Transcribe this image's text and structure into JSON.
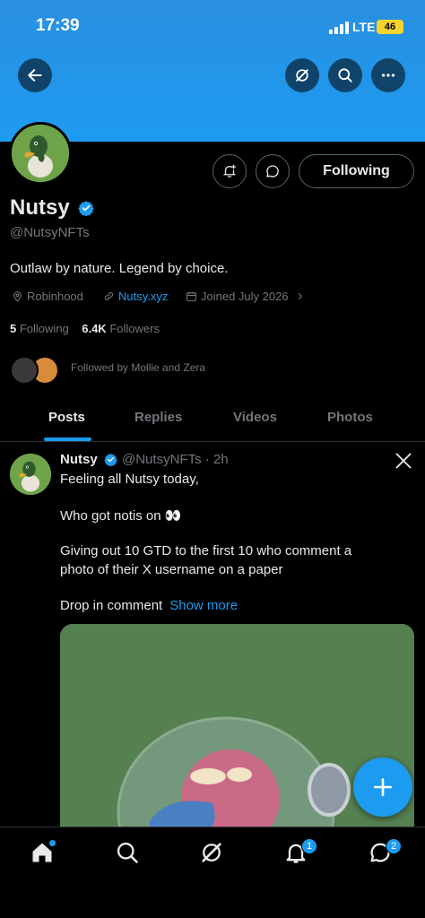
{
  "status_bar": {
    "time": "17:39",
    "network": "LTE",
    "battery": "46"
  },
  "profile": {
    "name": "Nutsy",
    "handle": "@NutsyNFTs",
    "bio": "Outlaw by nature. Legend by choice.",
    "location": "Robinhood",
    "website": "Nutsy.xyz",
    "joined": "Joined July 2026",
    "following_count": "5",
    "following_label": "Following",
    "followers_count": "6.4K",
    "followers_label": "Followers",
    "followed_by": "Followed by Mollie and Zera",
    "follow_button": "Following"
  },
  "tabs": [
    {
      "label": "Posts",
      "active": true
    },
    {
      "label": "Replies",
      "active": false
    },
    {
      "label": "Videos",
      "active": false
    },
    {
      "label": "Photos",
      "active": false
    }
  ],
  "post": {
    "author": "Nutsy",
    "handle_time": "@NutsyNFTs · 2h",
    "line1": "Feeling all Nutsy today,",
    "line2": "Who got notis on 👀",
    "line3": "Giving out 10 GTD to the first 10 who comment a",
    "line4": "photo of their X username on a paper",
    "line5": "Drop in  comment",
    "show_more": "Show more"
  },
  "bottom_nav": {
    "notifications_badge": "1",
    "messages_badge": "2"
  },
  "colors": {
    "accent": "#1d9bf0",
    "background": "#000000",
    "banner": "#1d9bf0"
  }
}
